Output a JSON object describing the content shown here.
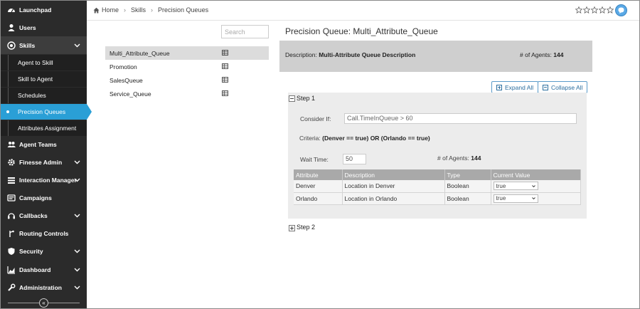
{
  "sidebar": {
    "items": [
      {
        "label": "Launchpad",
        "icon": "dashboard-icon"
      },
      {
        "label": "Users",
        "icon": "user-icon"
      },
      {
        "label": "Skills",
        "icon": "skills-icon",
        "expanded": true
      },
      {
        "label": "Agent Teams",
        "icon": "team-icon"
      },
      {
        "label": "Finesse Admin",
        "icon": "gear-icon"
      },
      {
        "label": "Interaction Manager",
        "icon": "list-icon"
      },
      {
        "label": "Campaigns",
        "icon": "campaign-icon"
      },
      {
        "label": "Callbacks",
        "icon": "headset-icon"
      },
      {
        "label": "Routing Controls",
        "icon": "routing-icon"
      },
      {
        "label": "Security",
        "icon": "shield-icon"
      },
      {
        "label": "Dashboard",
        "icon": "chart-icon"
      },
      {
        "label": "Administration",
        "icon": "wrench-icon"
      }
    ],
    "sub_items": [
      {
        "label": "Agent to Skill"
      },
      {
        "label": "Skill to Agent"
      },
      {
        "label": "Schedules"
      },
      {
        "label": "Precision Queues",
        "selected": true
      },
      {
        "label": "Attributes Assignment"
      }
    ],
    "collapse_glyph": "«"
  },
  "breadcrumb": {
    "items": [
      "Home",
      "Skills",
      "Precision Queues"
    ],
    "separator": "›"
  },
  "rating": {
    "stars": 5,
    "filled": 0
  },
  "search": {
    "placeholder": "Search"
  },
  "queues": [
    {
      "name": "Multi_Attribute_Queue",
      "selected": true
    },
    {
      "name": "Promotion"
    },
    {
      "name": "SalesQueue"
    },
    {
      "name": "Service_Queue"
    }
  ],
  "detail": {
    "title": "Precision Queue: Multi_Attribute_Queue",
    "description_label": "Description:",
    "description_value": "Multi-Attribute Queue Description",
    "agents_label": "# of Agents:",
    "agents_value": "144",
    "expand_all": "Expand All",
    "collapse_all": "Collapse All"
  },
  "step1": {
    "label": "Step 1",
    "consider_if_label": "Consider If:",
    "consider_if_value": "Call.TimeInQueue > 60",
    "criteria_label": "Criteria:",
    "criteria_value": "(Denver == true) OR (Orlando == true)",
    "wait_time_label": "Wait Time:",
    "wait_time_value": "50",
    "agents_label": "# of Agents:",
    "agents_value": "144",
    "table": {
      "headers": [
        "Attribute",
        "Description",
        "Type",
        "Current Value"
      ],
      "rows": [
        [
          "Denver",
          "Location in Denver",
          "Boolean",
          "true"
        ],
        [
          "Orlando",
          "Location in Orlando",
          "Boolean",
          "true"
        ]
      ]
    }
  },
  "step2": {
    "label": "Step 2"
  },
  "colors": {
    "sidebar_bg": "#2b2b2b",
    "accent": "#2a9fd6",
    "panel_bg": "#ececec",
    "table_header": "#a9a9a9"
  }
}
